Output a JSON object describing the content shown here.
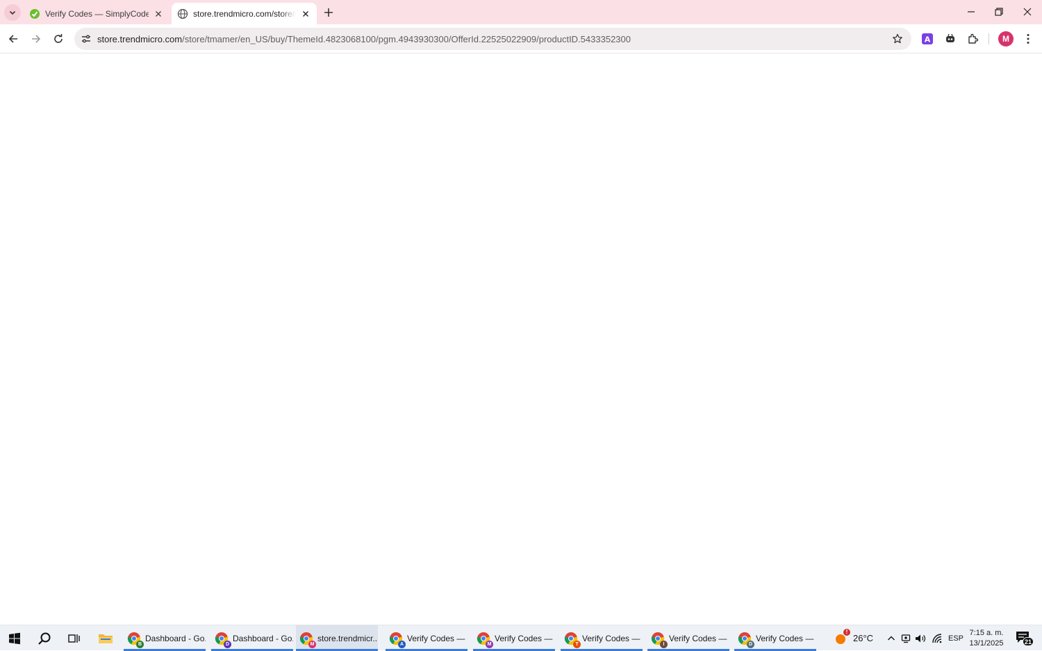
{
  "browser": {
    "tabs": [
      {
        "title": "Verify Codes — SimplyCodes",
        "active": false
      },
      {
        "title": "store.trendmicro.com/store/tmamer/en_US/buy/",
        "active": true
      }
    ],
    "url_host": "store.trendmicro.com",
    "url_path": "/store/tmamer/en_US/buy/ThemeId.4823068100/pgm.4943930300/OfferId.22525022909/productID.5433352300",
    "profile_initial": "M",
    "extension_icons": [
      "translate-extension-icon",
      "copilot-extension-icon",
      "extensions-puzzle-icon"
    ]
  },
  "taskbar": {
    "items": [
      {
        "label": "Dashboard - Go...",
        "badge": "B",
        "badge_color": "#2e7d32",
        "active": false
      },
      {
        "label": "Dashboard - Go...",
        "badge": "D",
        "badge_color": "#5e35b1",
        "active": false
      },
      {
        "label": "store.trendmicr...",
        "badge": "M",
        "badge_color": "#d6336c",
        "active": true
      },
      {
        "label": "Verify Codes — ...",
        "badge": "A",
        "badge_color": "#1e5bbf",
        "active": false
      },
      {
        "label": "Verify Codes — ...",
        "badge": "M",
        "badge_color": "#8e3bb5",
        "active": false
      },
      {
        "label": "Verify Codes — ...",
        "badge": "T",
        "badge_color": "#e65100",
        "active": false
      },
      {
        "label": "Verify Codes — ...",
        "badge": "I",
        "badge_color": "#6d4c41",
        "active": false
      },
      {
        "label": "Verify Codes — ...",
        "badge": "D",
        "badge_color": "#546e7a",
        "active": false
      }
    ],
    "weather": "26°C",
    "weather_alert": "!",
    "language": "ESP",
    "time": "7:15 a. m.",
    "date": "13/1/2025",
    "notifications_count": "21"
  },
  "colors": {
    "tabstrip": "#fbe0e6",
    "omnibox": "#f1edef",
    "taskbar": "#eef1f6",
    "accent": "#3b7cd6"
  }
}
